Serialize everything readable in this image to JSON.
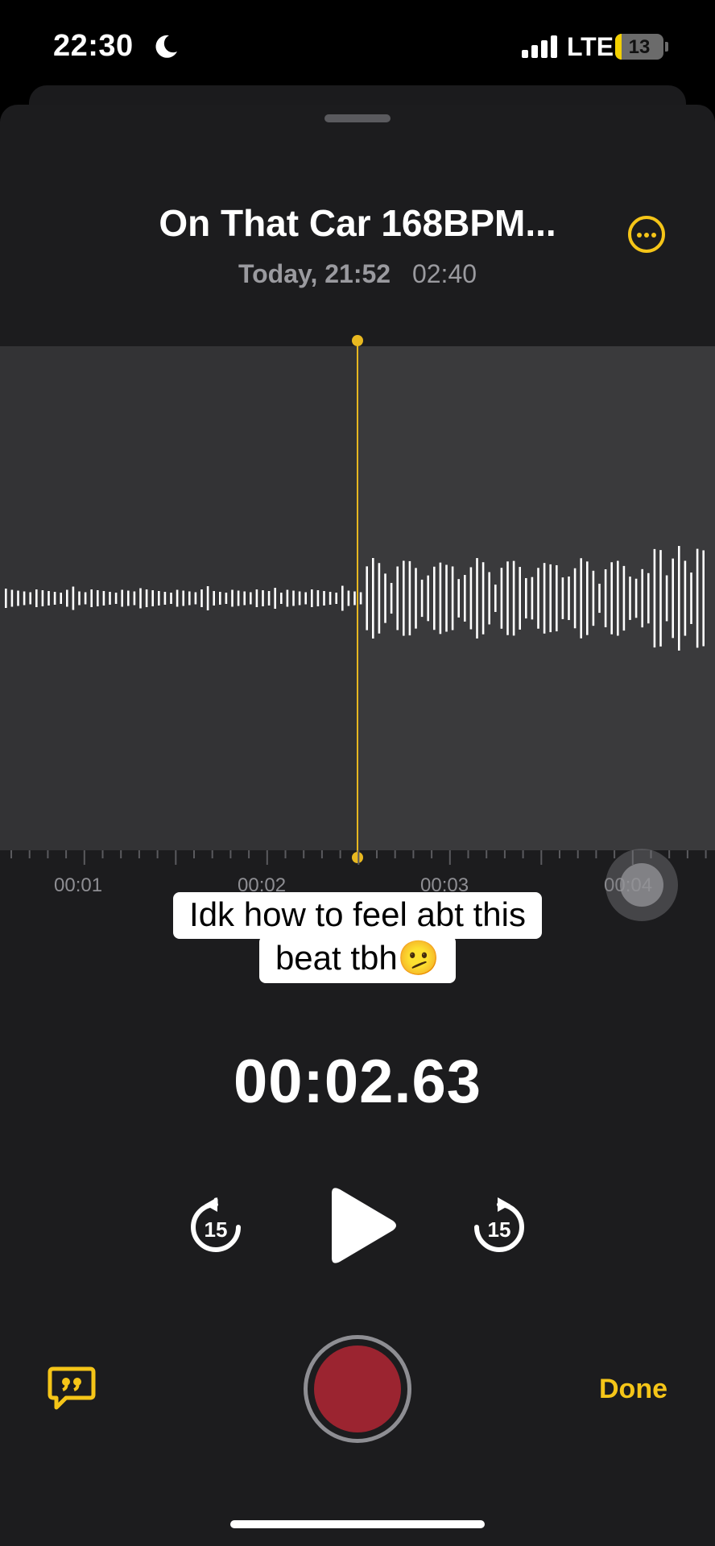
{
  "status_bar": {
    "time": "22:30",
    "network": "LTE",
    "battery": "13",
    "battery_level_percent": 13
  },
  "recording": {
    "title": "On That Car 168BPM...",
    "date": "Today, 21:52",
    "duration": "02:40"
  },
  "timeline": {
    "labels": [
      "00:01",
      "00:02",
      "00:03",
      "00:04"
    ]
  },
  "caption": {
    "line1": "Idk how to feel abt this",
    "line2": "beat tbh🫤"
  },
  "playback": {
    "current_time": "00:02.63",
    "skip_back_seconds": "15",
    "skip_forward_seconds": "15"
  },
  "toolbar": {
    "done_label": "Done"
  },
  "colors": {
    "accent": "#f5c518",
    "record": "#9b2430",
    "playhead": "#e8b820"
  },
  "icons": {
    "more": "ellipsis-circle-icon",
    "transcript": "quote-bubble-icon",
    "skip_back": "gobackward-15-icon",
    "skip_forward": "goforward-15-icon",
    "play": "play-icon"
  }
}
